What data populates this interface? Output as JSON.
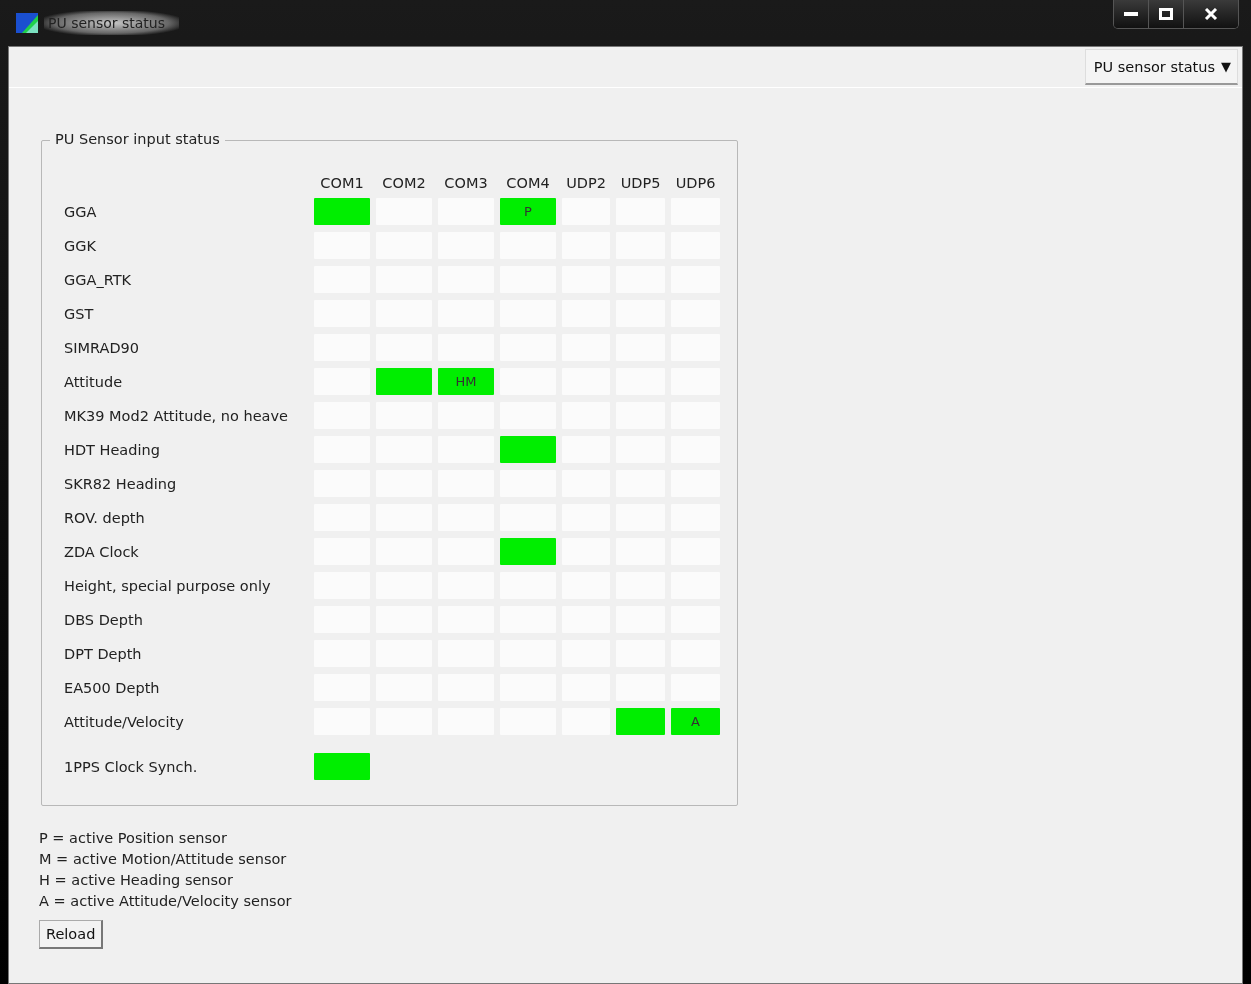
{
  "window": {
    "title": "PU sensor status"
  },
  "view_selector": {
    "label": "PU sensor status",
    "arrow": "▼"
  },
  "group": {
    "title": "PU Sensor input status",
    "columns": [
      "COM1",
      "COM2",
      "COM3",
      "COM4",
      "UDP2",
      "UDP5",
      "UDP6"
    ],
    "rows": [
      {
        "label": "GGA",
        "cells": [
          {
            "on": true
          },
          {
            "on": false
          },
          {
            "on": false
          },
          {
            "on": true,
            "text": "P"
          },
          {
            "on": false
          },
          {
            "on": false
          },
          {
            "on": false
          }
        ]
      },
      {
        "label": "GGK",
        "cells": [
          {
            "on": false
          },
          {
            "on": false
          },
          {
            "on": false
          },
          {
            "on": false
          },
          {
            "on": false
          },
          {
            "on": false
          },
          {
            "on": false
          }
        ]
      },
      {
        "label": "GGA_RTK",
        "cells": [
          {
            "on": false
          },
          {
            "on": false
          },
          {
            "on": false
          },
          {
            "on": false
          },
          {
            "on": false
          },
          {
            "on": false
          },
          {
            "on": false
          }
        ]
      },
      {
        "label": "GST",
        "cells": [
          {
            "on": false
          },
          {
            "on": false
          },
          {
            "on": false
          },
          {
            "on": false
          },
          {
            "on": false
          },
          {
            "on": false
          },
          {
            "on": false
          }
        ]
      },
      {
        "label": "SIMRAD90",
        "cells": [
          {
            "on": false
          },
          {
            "on": false
          },
          {
            "on": false
          },
          {
            "on": false
          },
          {
            "on": false
          },
          {
            "on": false
          },
          {
            "on": false
          }
        ]
      },
      {
        "label": "Attitude",
        "cells": [
          {
            "on": false
          },
          {
            "on": true
          },
          {
            "on": true,
            "text": "HM"
          },
          {
            "on": false
          },
          {
            "on": false
          },
          {
            "on": false
          },
          {
            "on": false
          }
        ]
      },
      {
        "label": "MK39 Mod2 Attitude, no heave",
        "cells": [
          {
            "on": false
          },
          {
            "on": false
          },
          {
            "on": false
          },
          {
            "on": false
          },
          {
            "on": false
          },
          {
            "on": false
          },
          {
            "on": false
          }
        ]
      },
      {
        "label": "HDT Heading",
        "cells": [
          {
            "on": false
          },
          {
            "on": false
          },
          {
            "on": false
          },
          {
            "on": true
          },
          {
            "on": false
          },
          {
            "on": false
          },
          {
            "on": false
          }
        ]
      },
      {
        "label": "SKR82 Heading",
        "cells": [
          {
            "on": false
          },
          {
            "on": false
          },
          {
            "on": false
          },
          {
            "on": false
          },
          {
            "on": false
          },
          {
            "on": false
          },
          {
            "on": false
          }
        ]
      },
      {
        "label": "ROV. depth",
        "cells": [
          {
            "on": false
          },
          {
            "on": false
          },
          {
            "on": false
          },
          {
            "on": false
          },
          {
            "on": false
          },
          {
            "on": false
          },
          {
            "on": false
          }
        ]
      },
      {
        "label": "ZDA Clock",
        "cells": [
          {
            "on": false
          },
          {
            "on": false
          },
          {
            "on": false
          },
          {
            "on": true
          },
          {
            "on": false
          },
          {
            "on": false
          },
          {
            "on": false
          }
        ]
      },
      {
        "label": "Height, special purpose only",
        "cells": [
          {
            "on": false
          },
          {
            "on": false
          },
          {
            "on": false
          },
          {
            "on": false
          },
          {
            "on": false
          },
          {
            "on": false
          },
          {
            "on": false
          }
        ]
      },
      {
        "label": "DBS Depth",
        "cells": [
          {
            "on": false
          },
          {
            "on": false
          },
          {
            "on": false
          },
          {
            "on": false
          },
          {
            "on": false
          },
          {
            "on": false
          },
          {
            "on": false
          }
        ]
      },
      {
        "label": "DPT Depth",
        "cells": [
          {
            "on": false
          },
          {
            "on": false
          },
          {
            "on": false
          },
          {
            "on": false
          },
          {
            "on": false
          },
          {
            "on": false
          },
          {
            "on": false
          }
        ]
      },
      {
        "label": "EA500 Depth",
        "cells": [
          {
            "on": false
          },
          {
            "on": false
          },
          {
            "on": false
          },
          {
            "on": false
          },
          {
            "on": false
          },
          {
            "on": false
          },
          {
            "on": false
          }
        ]
      },
      {
        "label": "Attitude/Velocity",
        "cells": [
          {
            "on": false
          },
          {
            "on": false
          },
          {
            "on": false
          },
          {
            "on": false
          },
          {
            "on": false
          },
          {
            "on": true
          },
          {
            "on": true,
            "text": "A"
          }
        ]
      }
    ],
    "sync": {
      "label": "1PPS Clock Synch.",
      "on": true
    }
  },
  "legend": [
    "P = active Position sensor",
    "M = active Motion/Attitude sensor",
    "H = active Heading sensor",
    "A = active Attitude/Velocity sensor"
  ],
  "buttons": [
    {
      "label": "Reload"
    }
  ]
}
